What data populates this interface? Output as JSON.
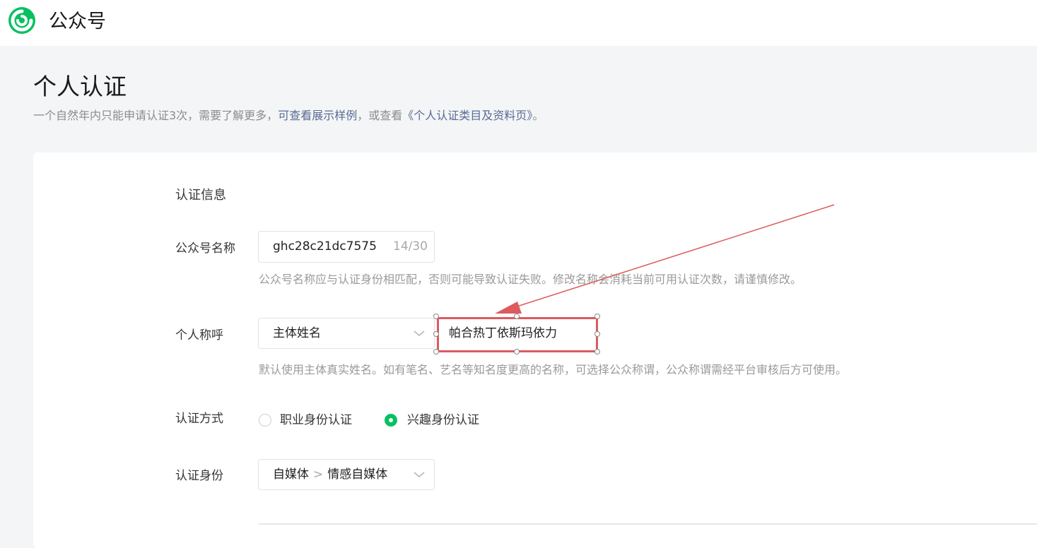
{
  "header": {
    "brand": "公众号",
    "logo_icon": "wechat-mp-logo",
    "accent_color": "#07c160"
  },
  "page": {
    "title": "个人认证",
    "desc_prefix": "一个自然年内只能申请认证3次，需要了解更多，",
    "desc_link1": "可查看展示样例",
    "desc_middle": "，或查看",
    "desc_link2": "《个人认证类目及资料页》",
    "desc_suffix": "。"
  },
  "form": {
    "section_title": "认证信息",
    "name": {
      "label": "公众号名称",
      "value": "ghc28c21dc7575",
      "counter": "14/30",
      "hint": "公众号名称应与认证身份相匹配，否则可能导致认证失败。修改名称会消耗当前可用认证次数，请谨慎修改。"
    },
    "title": {
      "label": "个人称呼",
      "select_value": "主体姓名",
      "input_value": "帕合热丁依斯玛依力",
      "hint": "默认使用主体真实姓名。如有笔名、艺名等知名度更高的名称，可选择公众称谓，公众称谓需经平台审核后方可使用。"
    },
    "method": {
      "label": "认证方式",
      "options": [
        "职业身份认证",
        "兴趣身份认证"
      ],
      "selected": "兴趣身份认证"
    },
    "identity": {
      "label": "认证身份",
      "level1": "自媒体",
      "separator": ">",
      "level2": "情感自媒体"
    }
  },
  "annotation": {
    "color": "#dd5a5e"
  }
}
